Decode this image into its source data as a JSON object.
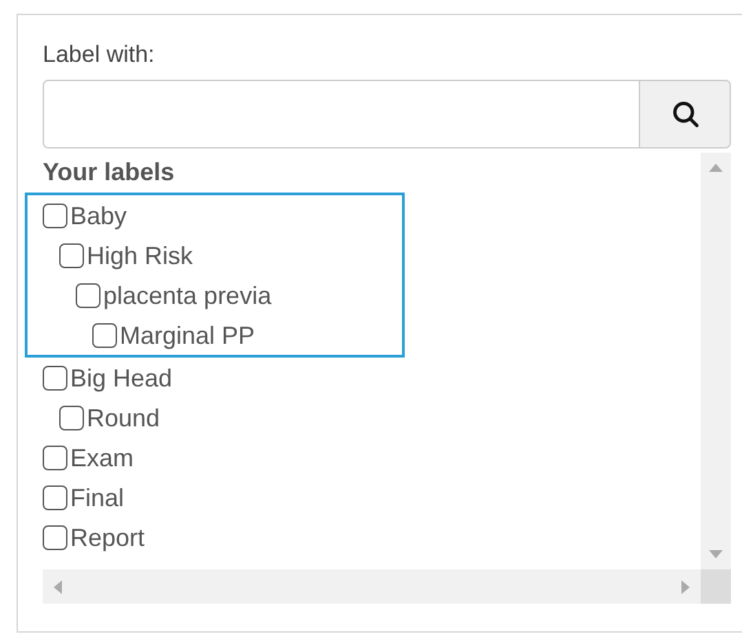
{
  "search": {
    "label": "Label with:"
  },
  "labels_heading": "Your labels",
  "labels": [
    {
      "name": "Baby",
      "checked": false,
      "highlighted": true,
      "children": [
        {
          "name": "High Risk",
          "checked": false,
          "children": [
            {
              "name": "placenta previa",
              "checked": false,
              "children": [
                {
                  "name": "Marginal PP",
                  "checked": false
                }
              ]
            }
          ]
        }
      ]
    },
    {
      "name": "Big Head",
      "checked": false,
      "highlighted": false,
      "children": [
        {
          "name": "Round",
          "checked": false
        }
      ]
    },
    {
      "name": "Exam",
      "checked": false,
      "highlighted": false
    },
    {
      "name": "Final",
      "checked": false,
      "highlighted": false
    },
    {
      "name": "Report",
      "checked": false,
      "highlighted": false
    }
  ]
}
